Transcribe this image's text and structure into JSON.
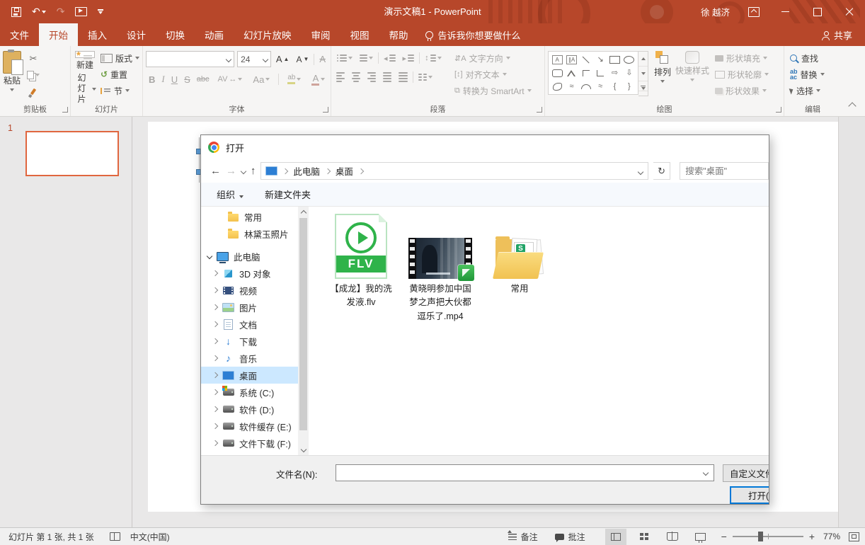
{
  "titlebar": {
    "title": "演示文稿1 - PowerPoint",
    "user": "徐 越济"
  },
  "tabs": [
    "文件",
    "开始",
    "插入",
    "设计",
    "切换",
    "动画",
    "幻灯片放映",
    "审阅",
    "视图",
    "帮助"
  ],
  "tell_me": "告诉我你想要做什么",
  "share_label": "共享",
  "icons": {
    "undo": "↶",
    "redo": "↷",
    "refresh": "↻",
    "back": "←",
    "forward": "→",
    "up": "↑",
    "download_arrow": "↓",
    "music_note": "♪",
    "diag_arrow": "↘",
    "block_arrow_right": "⇨",
    "block_arrow_down": "⇩",
    "brace_left": "{",
    "brace_right": "}",
    "scribble": "≈",
    "grow_font": "A",
    "shrink_font": "A",
    "line_spacing_arrows": "↕"
  },
  "ribbon": {
    "clipboard": {
      "label": "剪贴板",
      "paste": "粘贴"
    },
    "slides": {
      "label": "幻灯片",
      "new_slide_line1": "新建",
      "new_slide_line2": "幻灯片",
      "layout": "版式",
      "reset": "重置",
      "section": "节"
    },
    "font": {
      "label": "字体",
      "size": "24",
      "buttons": {
        "bold": "B",
        "italic": "I",
        "underline": "U",
        "strikethrough": "S",
        "abc": "abc",
        "char_spacing": "AV",
        "change_case": "Aa",
        "color": "A"
      }
    },
    "paragraph": {
      "label": "段落",
      "text_direction": "文字方向",
      "align_text": "对齐文本",
      "smartart": "转换为 SmartArt"
    },
    "drawing": {
      "label": "绘图",
      "arrange": "排列",
      "quick_styles": "快速样式",
      "shape_fill": "形状填充",
      "shape_outline": "形状轮廓",
      "shape_effects": "形状效果"
    },
    "editing": {
      "label": "编辑",
      "find": "查找",
      "replace": "替换",
      "select": "选择"
    }
  },
  "slides_panel": {
    "slide_number": "1"
  },
  "dialog": {
    "title": "打开",
    "breadcrumb": [
      "此电脑",
      "桌面"
    ],
    "search_placeholder": "搜索\"桌面\"",
    "organize": "组织",
    "new_folder": "新建文件夹",
    "tree": [
      {
        "label": "常用"
      },
      {
        "label": "林黛玉照片"
      },
      {
        "label": "此电脑"
      },
      {
        "label": "3D 对象"
      },
      {
        "label": "视频"
      },
      {
        "label": "图片"
      },
      {
        "label": "文档"
      },
      {
        "label": "下载"
      },
      {
        "label": "音乐"
      },
      {
        "label": "桌面"
      },
      {
        "label": "系统 (C:)"
      },
      {
        "label": "软件 (D:)"
      },
      {
        "label": "软件缓存 (E:)"
      },
      {
        "label": "文件下载 (F:)"
      }
    ],
    "files": [
      {
        "name": "【成龙】我的洗发液.flv",
        "ext": "FLV"
      },
      {
        "name": "黄晓明参加中国梦之声把大伙都逗乐了.mp4"
      },
      {
        "name": "常用"
      }
    ],
    "filename_label": "文件名(N):",
    "filename_value": "",
    "filetype_button": "自定义文件",
    "open_button": "打开(O)"
  },
  "statusbar": {
    "slide_info": "幻灯片 第 1 张, 共 1 张",
    "language": "中文(中国)",
    "notes": "备注",
    "comments": "批注",
    "zoom_level": "77%"
  }
}
